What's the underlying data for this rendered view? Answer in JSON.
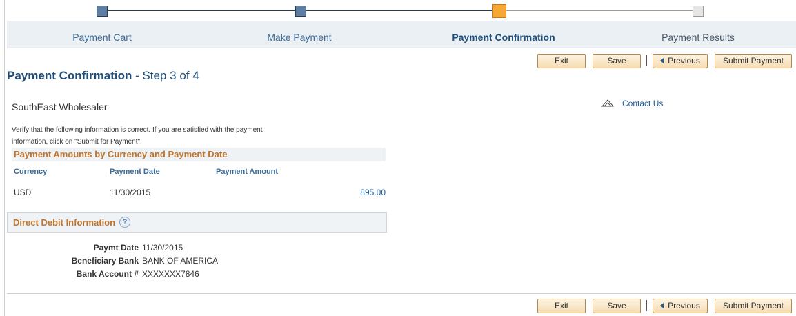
{
  "train": {
    "steps": [
      {
        "label": "Payment Cart",
        "state": "done"
      },
      {
        "label": "Make Payment",
        "state": "done"
      },
      {
        "label": "Payment Confirmation",
        "state": "current"
      },
      {
        "label": "Payment Results",
        "state": "future"
      }
    ]
  },
  "toolbar": {
    "exit_label": "Exit",
    "save_label": "Save",
    "previous_label": "Previous",
    "submit_label": "Submit Payment"
  },
  "page": {
    "title": "Payment Confirmation",
    "step_text": " - Step 3 of 4",
    "customer_name": "SouthEast Wholesaler",
    "contact_label": "Contact Us",
    "instructions": "Verify that the following information is correct. If you are satisfied with the payment information, click on \"Submit for Payment\"."
  },
  "amounts_grid": {
    "title": "Payment Amounts by Currency and Payment Date",
    "headers": {
      "currency": "Currency",
      "payment_date": "Payment Date",
      "payment_amount": "Payment Amount"
    },
    "rows": [
      {
        "currency": "USD",
        "payment_date": "11/30/2015",
        "payment_amount": "895.00"
      }
    ]
  },
  "direct_debit": {
    "title": "Direct Debit Information",
    "help_glyph": "?",
    "fields": [
      {
        "label": "Paymt Date",
        "value": "11/30/2015"
      },
      {
        "label": "Beneficiary Bank",
        "value": "BANK OF AMERICA"
      },
      {
        "label": "Bank Account #",
        "value": "XXXXXXX7846"
      }
    ]
  },
  "colors": {
    "accent_blue": "#1f4d78",
    "section_orange": "#c0752d",
    "current_step": "#f6a833",
    "done_step": "#5c7fa3"
  }
}
